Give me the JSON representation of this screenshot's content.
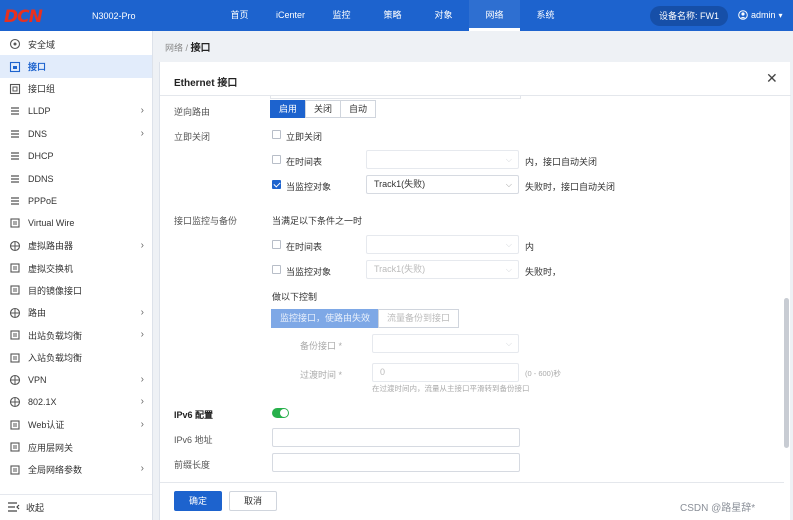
{
  "header": {
    "logo": "DCN",
    "model": "N3002-Pro",
    "nav": [
      "首页",
      "iCenter",
      "监控",
      "策略",
      "对象",
      "网络",
      "系统"
    ],
    "active_nav": 5,
    "device": "设备名称: FW1",
    "user": "admin"
  },
  "sidebar": {
    "items": [
      {
        "label": "安全域",
        "icon": "shield-icon",
        "chevron": false
      },
      {
        "label": "接口",
        "icon": "interface-icon",
        "chevron": false,
        "active": true
      },
      {
        "label": "接口组",
        "icon": "interface-group-icon",
        "chevron": false
      },
      {
        "label": "LLDP",
        "icon": "lldp-icon",
        "chevron": true
      },
      {
        "label": "DNS",
        "icon": "dns-icon",
        "chevron": true
      },
      {
        "label": "DHCP",
        "icon": "dhcp-icon",
        "chevron": false
      },
      {
        "label": "DDNS",
        "icon": "ddns-icon",
        "chevron": false
      },
      {
        "label": "PPPoE",
        "icon": "pppoe-icon",
        "chevron": false
      },
      {
        "label": "Virtual Wire",
        "icon": "virtual-wire-icon",
        "chevron": false
      },
      {
        "label": "虚拟路由器",
        "icon": "virtual-router-icon",
        "chevron": true
      },
      {
        "label": "虚拟交换机",
        "icon": "virtual-switch-icon",
        "chevron": false
      },
      {
        "label": "目的镜像接口",
        "icon": "mirror-icon",
        "chevron": false
      },
      {
        "label": "路由",
        "icon": "route-icon",
        "chevron": true
      },
      {
        "label": "出站负载均衡",
        "icon": "outbound-lb-icon",
        "chevron": true
      },
      {
        "label": "入站负载均衡",
        "icon": "inbound-lb-icon",
        "chevron": false
      },
      {
        "label": "VPN",
        "icon": "vpn-icon",
        "chevron": true
      },
      {
        "label": "802.1X",
        "icon": "dot1x-icon",
        "chevron": true
      },
      {
        "label": "Web认证",
        "icon": "web-auth-icon",
        "chevron": true
      },
      {
        "label": "应用层网关",
        "icon": "alg-icon",
        "chevron": false
      },
      {
        "label": "全局网络参数",
        "icon": "global-params-icon",
        "chevron": true
      }
    ],
    "collapse": "收起"
  },
  "breadcrumb": {
    "parent": "网络",
    "sep": "/",
    "current": "接口"
  },
  "panel": {
    "title": "Ethernet 接口",
    "reverse_route": {
      "label": "逆向路由",
      "options": [
        "启用",
        "关闭",
        "自动"
      ],
      "selected": 0
    },
    "immediate_shutdown": {
      "label": "立即关闭",
      "checkbox": "立即关闭",
      "schedule_label": "在时间表",
      "schedule_suffix": "内，接口自动关闭",
      "monitor_label": "当监控对象",
      "monitor_value": "Track1(失败)",
      "monitor_suffix": "失败时，接口自动关闭"
    },
    "backup": {
      "label": "接口监控与备份",
      "condition": "当满足以下条件之一时",
      "schedule_label": "在时间表",
      "schedule_suffix": "内",
      "monitor_label": "当监控对象",
      "monitor_value": "Track1(失败)",
      "monitor_suffix": "失败时，",
      "action_label": "做以下控制",
      "actions": [
        "监控接口，使路由失效",
        "流量备份到接口"
      ],
      "backup_iface_label": "备份接口 *",
      "transition_label": "过渡时间 *",
      "transition_value": "0",
      "transition_range": "(0 - 600)秒",
      "transition_hint": "在过渡时间内，流量从主接口平滑转到备份接口"
    },
    "ipv6": {
      "label": "IPv6 配置",
      "enabled": true,
      "addr_label": "IPv6 地址",
      "prefix_label": "前缀长度"
    },
    "footer": {
      "ok": "确定",
      "cancel": "取消"
    }
  },
  "watermark": "CSDN @路星辞*",
  "colors": {
    "primary": "#1d63ce",
    "toggle_on": "#27b04b",
    "logo": "#e8301f"
  }
}
